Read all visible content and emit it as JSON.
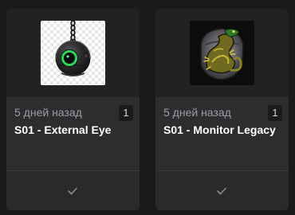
{
  "items": [
    {
      "date": "5 дней назад",
      "count": "1",
      "title": "S01 - External Eye",
      "thumbnail_icon": "mechanical-eye-orb-icon"
    },
    {
      "date": "5 дней назад",
      "count": "1",
      "title": "S01 - Monitor Legacy",
      "thumbnail_icon": "monitor-lizard-emblem-icon"
    }
  ],
  "colors": {
    "background": "#1a1a1d",
    "card": "#272729",
    "text": "#ffffff",
    "muted": "#9c9ca3",
    "accent_green": "#2fd35a"
  },
  "footer_icon": "checkmark-icon"
}
